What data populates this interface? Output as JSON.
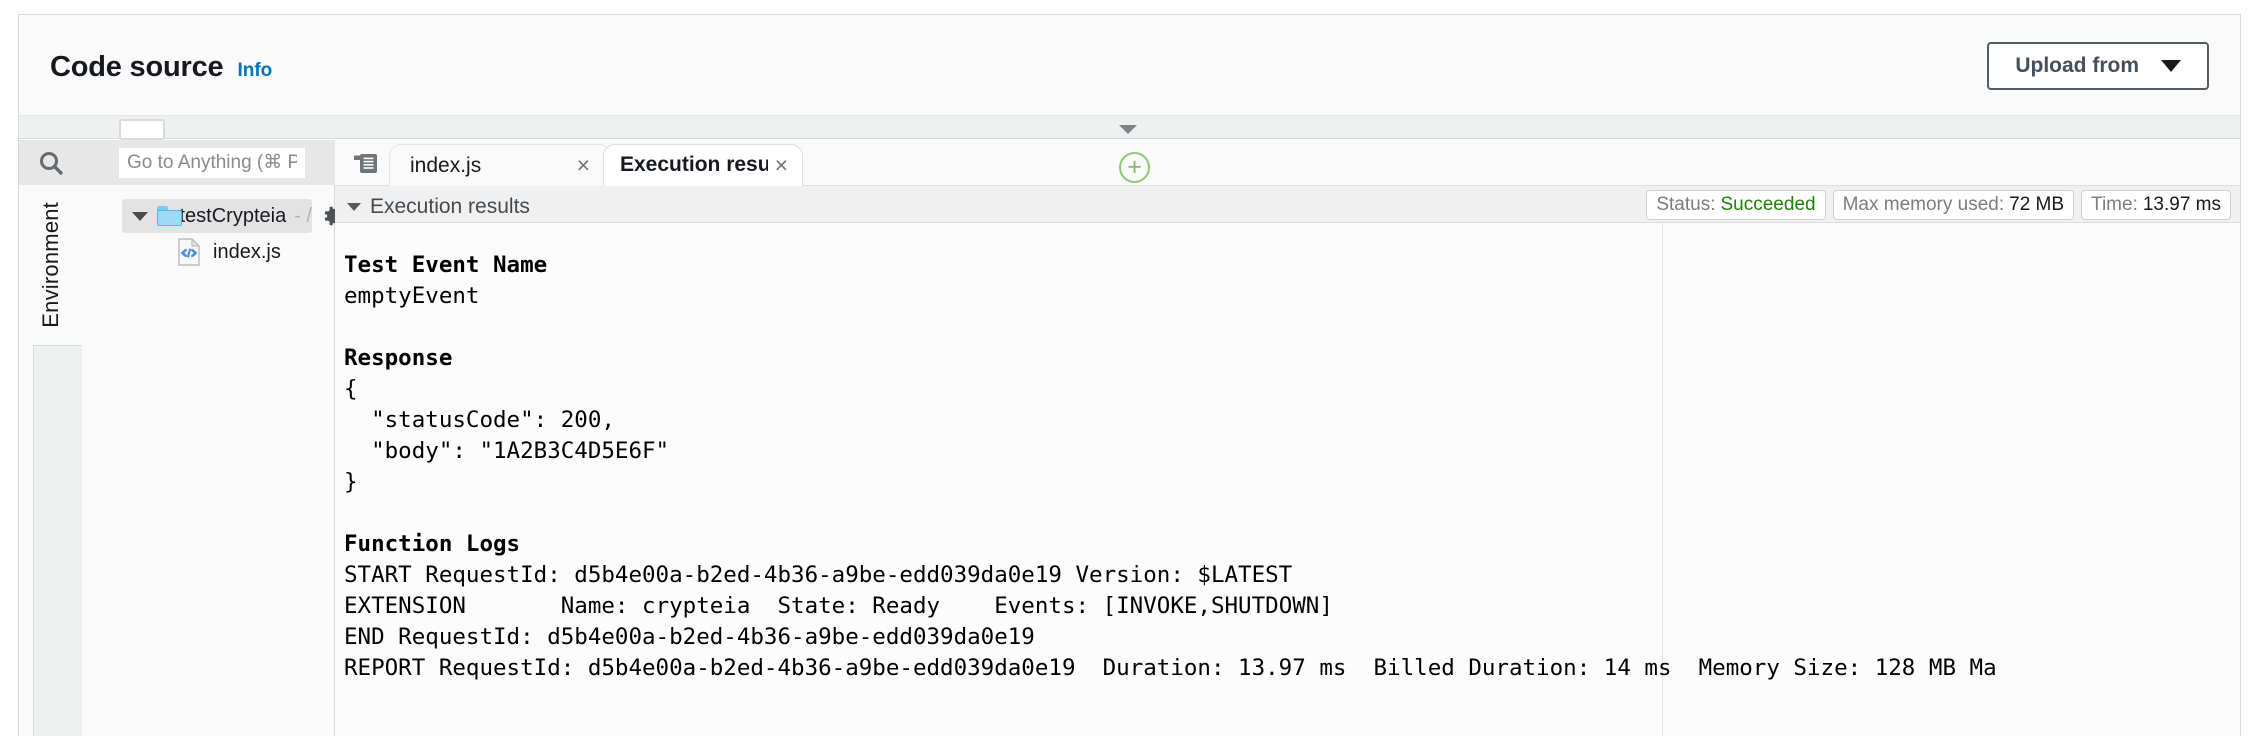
{
  "header": {
    "title": "Code source",
    "info_link": "Info",
    "upload_button": "Upload from"
  },
  "sidebar": {
    "search_placeholder": "Go to Anything (⌘ P)",
    "search_value": "",
    "env_tab_label": "Environment",
    "tree": {
      "root_name": "testCrypteia",
      "root_meta": "- /",
      "children": [
        {
          "name": "index.js",
          "icon": "js-file-icon"
        }
      ]
    }
  },
  "editor": {
    "tabs": [
      {
        "label": "index.js",
        "active": false,
        "close": "×"
      },
      {
        "label": "Execution results",
        "active": true,
        "close": "×"
      }
    ],
    "add_tab_glyph": "+"
  },
  "results": {
    "panel_label": "Execution results",
    "badges": [
      {
        "label": "Status:",
        "value": "Succeeded",
        "value_color": "#1d8102"
      },
      {
        "label": "Max memory used:",
        "value": "72 MB",
        "value_color": "#16191f"
      },
      {
        "label": "Time:",
        "value": "13.97 ms",
        "value_color": "#16191f"
      }
    ],
    "test_event_name_heading": "Test Event Name",
    "test_event_name": "emptyEvent",
    "response_heading": "Response",
    "response_body": "{\n  \"statusCode\": 200,\n  \"body\": \"1A2B3C4D5E6F\"\n}",
    "function_logs_heading": "Function Logs",
    "function_logs": "START RequestId: d5b4e00a-b2ed-4b36-a9be-edd039da0e19 Version: $LATEST\nEXTENSION\tName: crypteia\tState: Ready\tEvents: [INVOKE,SHUTDOWN]\nEND RequestId: d5b4e00a-b2ed-4b36-a9be-edd039da0e19\nREPORT RequestId: d5b4e00a-b2ed-4b36-a9be-edd039da0e19  Duration: 13.97 ms  Billed Duration: 14 ms  Memory Size: 128 MB Ma"
  },
  "colors": {
    "link": "#0073bb",
    "success": "#1d8102",
    "add_tab": "#8fc87a",
    "folder": "#9ed9f5"
  }
}
